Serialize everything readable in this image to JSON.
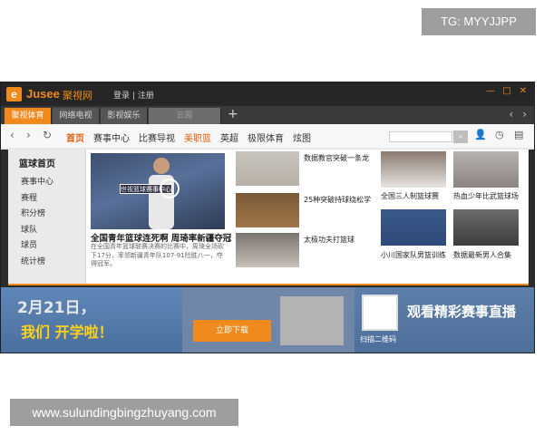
{
  "watermark": {
    "tg": "TG: MYYJJPP",
    "url": "www.sulundingbingzhuyang.com"
  },
  "titlebar": {
    "logo_letter": "e",
    "logo_brand": "Jusee",
    "logo_sub": "聚視网",
    "login": "登录",
    "register": "注册"
  },
  "tabs": [
    {
      "label": "聚视体育"
    },
    {
      "label": "网络电视"
    },
    {
      "label": "影视娱乐"
    },
    {
      "label": "云霞"
    }
  ],
  "nav": {
    "items": [
      {
        "label": "首页"
      },
      {
        "label": "赛事中心"
      },
      {
        "label": "比赛导视"
      },
      {
        "label": "美职篮"
      },
      {
        "label": "英超"
      },
      {
        "label": "极限体育"
      },
      {
        "label": "炫图"
      }
    ],
    "search_placeholder": ""
  },
  "sidebar": {
    "title": "篮球首页",
    "items": [
      "赛事中心",
      "赛程",
      "积分榜",
      "球队",
      "球员",
      "统计榜"
    ]
  },
  "hero": {
    "badge": "世视篮球赛事中心",
    "title": "全国青年篮球连死啊 周琦率新疆夺冠",
    "desc": "在全国青年篮球联赛决赛的比赛中，周琦全场砍下17分，率领新疆青年队107-91险胜八一，夺得冠军。"
  },
  "thumbs": [
    {
      "caption": "数据教官突破一条龙"
    },
    {
      "caption": "25种突破持球绕松学"
    },
    {
      "caption": "太极功夫打篮球"
    },
    {
      "caption": "全国三人制篮球赛"
    },
    {
      "caption": "热血少年比武篮球场"
    },
    {
      "caption": "小川国家队男篮训练"
    },
    {
      "caption": "数据最新男人合集"
    }
  ],
  "banner": {
    "left_line1": "2月21日，",
    "left_line2": "我们 开学啦！",
    "button": "立即下载",
    "qr_label": "扫描二维码",
    "right_text": "观看精彩赛事直播"
  }
}
